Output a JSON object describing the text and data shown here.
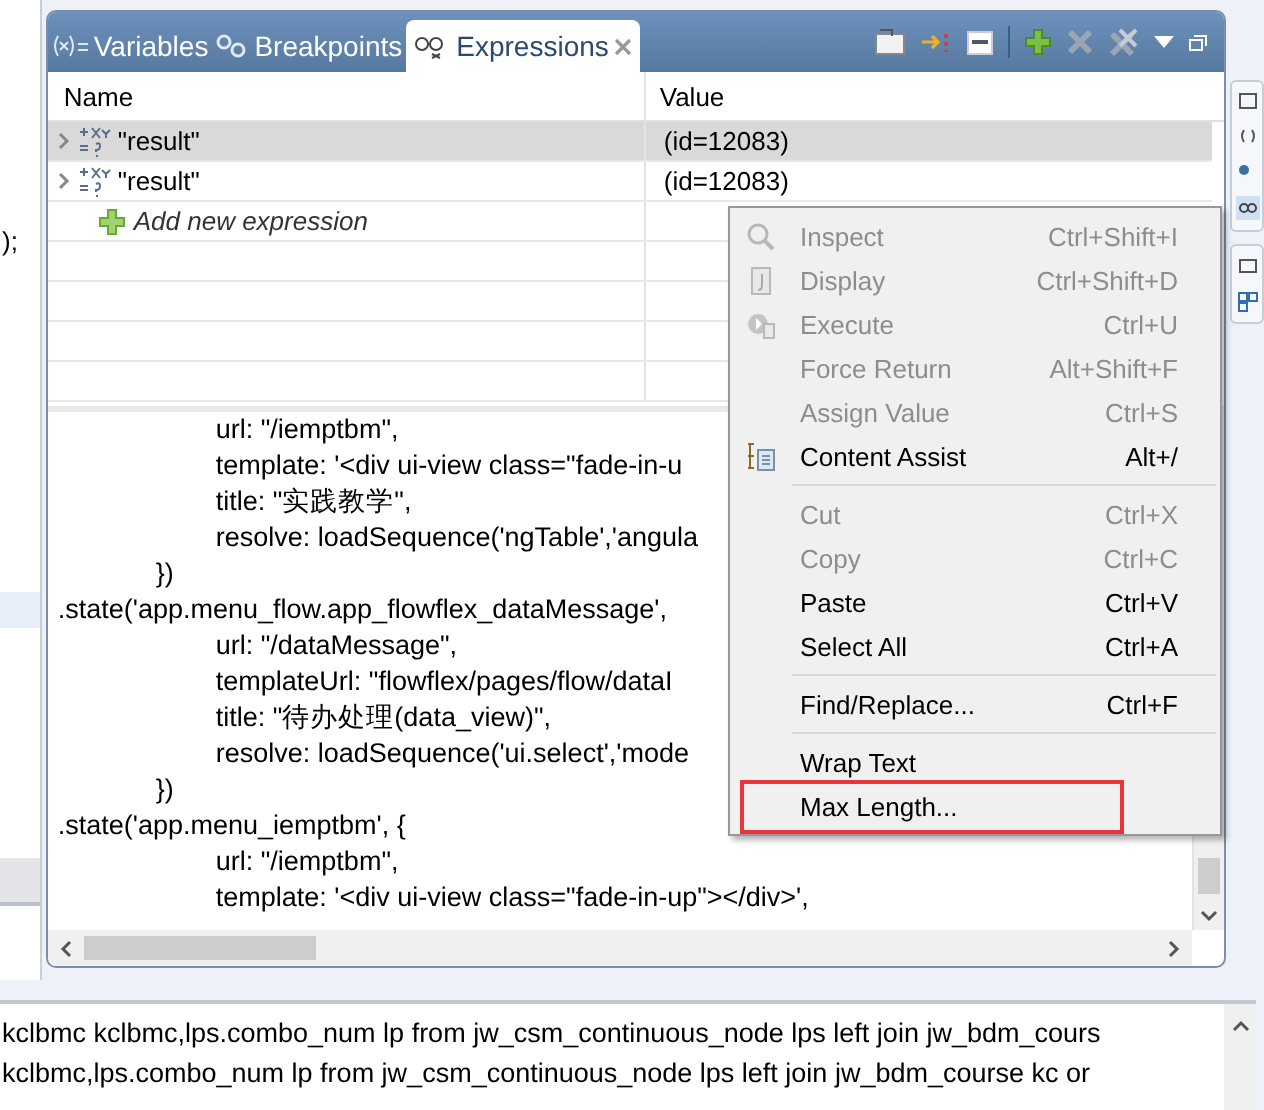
{
  "left_editor": {
    "text": ");"
  },
  "view": {
    "tabs": [
      {
        "label": "Variables",
        "selected": false
      },
      {
        "label": "Breakpoints",
        "selected": false
      },
      {
        "label": "Expressions",
        "selected": true
      }
    ],
    "columns": [
      "Name",
      "Value"
    ],
    "rows": [
      {
        "name": "\"result\"",
        "value": "(id=12083)",
        "selected": true
      },
      {
        "name": "\"result\"",
        "value": "(id=12083)",
        "selected": false
      }
    ],
    "add_expression": "Add new expression",
    "code_lines": [
      {
        "kind": "property",
        "text": "url: \"/iemptbm\","
      },
      {
        "kind": "property",
        "text": "template: '<div ui-view class=\"fade-in-u"
      },
      {
        "kind": "property",
        "text": "title: \"实践教学\","
      },
      {
        "kind": "property",
        "text": "resolve: loadSequence('ngTable','angula"
      },
      {
        "kind": "close",
        "text": "})"
      },
      {
        "kind": "statement",
        "text": ".state('app.menu_flow.app_flowflex_dataMessage',"
      },
      {
        "kind": "property",
        "text": "url: \"/dataMessage\","
      },
      {
        "kind": "property",
        "text": "templateUrl: \"flowflex/pages/flow/dataI"
      },
      {
        "kind": "property",
        "text": "title: \"待办处理(data_view)\","
      },
      {
        "kind": "property",
        "text": "resolve: loadSequence('ui.select','mode"
      },
      {
        "kind": "close",
        "text": "})"
      },
      {
        "kind": "statement",
        "text": ".state('app.menu_iemptbm', {"
      },
      {
        "kind": "property",
        "text": "url: \"/iemptbm\","
      },
      {
        "kind": "property",
        "text": "template: '<div ui-view class=\"fade-in-up\"></div>',"
      }
    ]
  },
  "context_menu": [
    {
      "kind": "item",
      "label": "Inspect",
      "shortcut": "Ctrl+Shift+I",
      "disabled": true,
      "highlighted": false
    },
    {
      "kind": "item",
      "label": "Display",
      "shortcut": "Ctrl+Shift+D",
      "disabled": true,
      "highlighted": false
    },
    {
      "kind": "item",
      "label": "Execute",
      "shortcut": "Ctrl+U",
      "disabled": true,
      "highlighted": false
    },
    {
      "kind": "item",
      "label": "Force Return",
      "shortcut": "Alt+Shift+F",
      "disabled": true,
      "highlighted": false
    },
    {
      "kind": "item",
      "label": "Assign Value",
      "shortcut": "Ctrl+S",
      "disabled": true,
      "highlighted": false
    },
    {
      "kind": "item",
      "label": "Content Assist",
      "shortcut": "Alt+/",
      "disabled": false,
      "highlighted": false
    },
    {
      "kind": "separator"
    },
    {
      "kind": "item",
      "label": "Cut",
      "shortcut": "Ctrl+X",
      "disabled": true,
      "highlighted": false
    },
    {
      "kind": "item",
      "label": "Copy",
      "shortcut": "Ctrl+C",
      "disabled": true,
      "highlighted": false
    },
    {
      "kind": "item",
      "label": "Paste",
      "shortcut": "Ctrl+V",
      "disabled": false,
      "highlighted": false
    },
    {
      "kind": "item",
      "label": "Select All",
      "shortcut": "Ctrl+A",
      "disabled": false,
      "highlighted": false
    },
    {
      "kind": "separator"
    },
    {
      "kind": "item",
      "label": "Find/Replace...",
      "shortcut": "Ctrl+F",
      "disabled": false,
      "highlighted": false
    },
    {
      "kind": "separator"
    },
    {
      "kind": "item",
      "label": "Wrap Text",
      "disabled": false,
      "highlighted": false
    },
    {
      "kind": "item",
      "label": "Max Length...",
      "disabled": false,
      "highlighted": true
    }
  ],
  "console_lines": [
    "kclbmc kclbmc,lps.combo_num lp from jw_csm_continuous_node lps left join jw_bdm_cours",
    "kclbmc,lps.combo_num lp from jw_csm_continuous_node lps left join jw_bdm_course kc or"
  ]
}
